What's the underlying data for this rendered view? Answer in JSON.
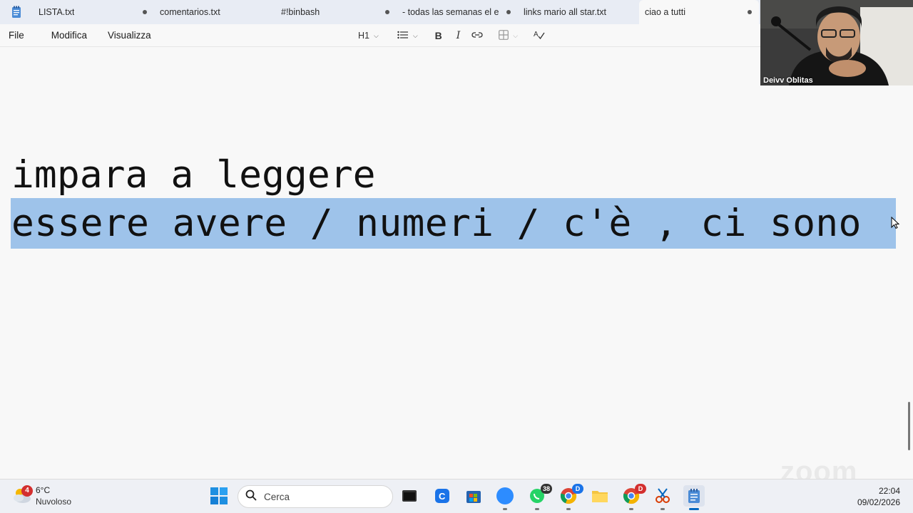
{
  "tabs": [
    {
      "label": "LISTA.txt",
      "modified": true,
      "active": false
    },
    {
      "label": "comentarios.txt",
      "modified": false,
      "active": false
    },
    {
      "label": "#!binbash",
      "modified": true,
      "active": false
    },
    {
      "label": "- todas las semanas el e",
      "modified": true,
      "active": false
    },
    {
      "label": "links mario all star.txt",
      "modified": false,
      "active": false
    },
    {
      "label": "ciao a tutti",
      "modified": true,
      "active": true
    }
  ],
  "menu": {
    "file": "File",
    "edit": "Modifica",
    "view": "Visualizza"
  },
  "toolbar": {
    "heading": "H1",
    "icons": [
      "list-icon",
      "bold-icon",
      "italic-icon",
      "link-icon",
      "table-icon",
      "spellcheck-icon"
    ]
  },
  "editor": {
    "line1": "impara a leggere",
    "line2": "essere avere / numeri / c'è , ci sono "
  },
  "webcam": {
    "participant": "Deivv Oblitas"
  },
  "watermark": "zoom",
  "taskbar": {
    "weather": {
      "badge": "4",
      "temp": "6°C",
      "desc": "Nuvoloso"
    },
    "search_placeholder": "Cerca",
    "apps": [
      {
        "name": "terminal",
        "badge": ""
      },
      {
        "name": "c-app",
        "badge": ""
      },
      {
        "name": "store",
        "badge": ""
      },
      {
        "name": "zoom",
        "badge": "",
        "label": "zoom"
      },
      {
        "name": "whatsapp",
        "badge": "38"
      },
      {
        "name": "chrome-1",
        "badge": "D"
      },
      {
        "name": "explorer",
        "badge": ""
      },
      {
        "name": "chrome-2",
        "badge": "D"
      },
      {
        "name": "snipping",
        "badge": ""
      },
      {
        "name": "notepad",
        "badge": ""
      }
    ],
    "time": "22:04",
    "date": "09/02/2026"
  },
  "colors": {
    "selection": "#9ec3ea",
    "tabbar": "#e8ecf4",
    "accent": "#0067c0"
  }
}
